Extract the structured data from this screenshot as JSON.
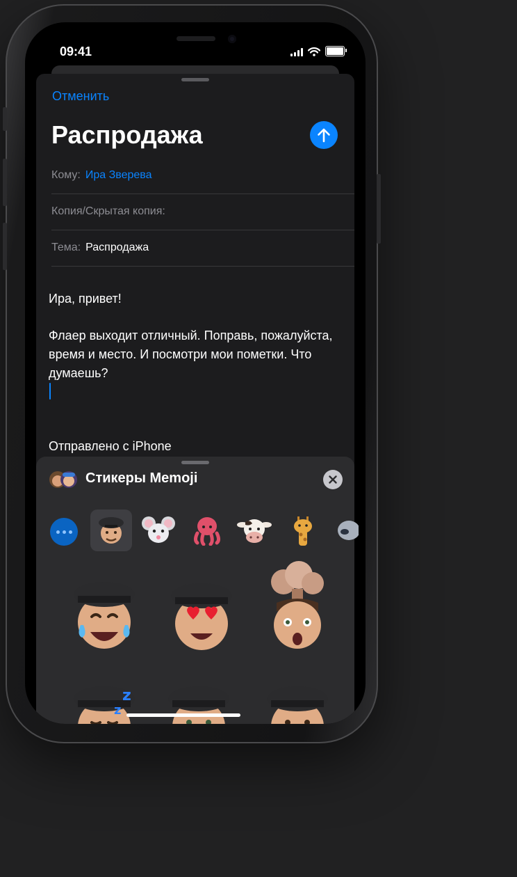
{
  "status_bar": {
    "time": "09:41",
    "icons": [
      "cellular-signal-icon",
      "wifi-icon",
      "battery-icon"
    ]
  },
  "compose": {
    "cancel_label": "Отменить",
    "title": "Распродажа",
    "send_icon": "arrow-up-icon",
    "to_label": "Кому:",
    "to_value": "Ира Зверева",
    "cc_label": "Копия/Скрытая копия:",
    "subject_label": "Тема:",
    "subject_value": "Распродажа",
    "body": {
      "greeting": "Ира, привет!",
      "paragraph": "Флаер выходит отличный. Поправь, пожалуйста, время и место. И посмотри мои пометки. Что думаешь?",
      "signature": "Отправлено с iPhone"
    }
  },
  "sticker_panel": {
    "title": "Стикеры Memoji",
    "close_icon": "close-icon",
    "more_icon": "ellipsis-icon",
    "categories": [
      "memoji-beret",
      "mouse",
      "octopus",
      "cow",
      "giraffe",
      "alien"
    ],
    "selected_category": "memoji-beret",
    "stickers": [
      "laughing-tears",
      "heart-eyes",
      "mind-blown",
      "sleeping",
      "smiling-wave",
      "thinking"
    ]
  },
  "colors": {
    "accent": "#0a84ff",
    "background": "#1c1c1e",
    "panel": "#2c2c2e"
  }
}
